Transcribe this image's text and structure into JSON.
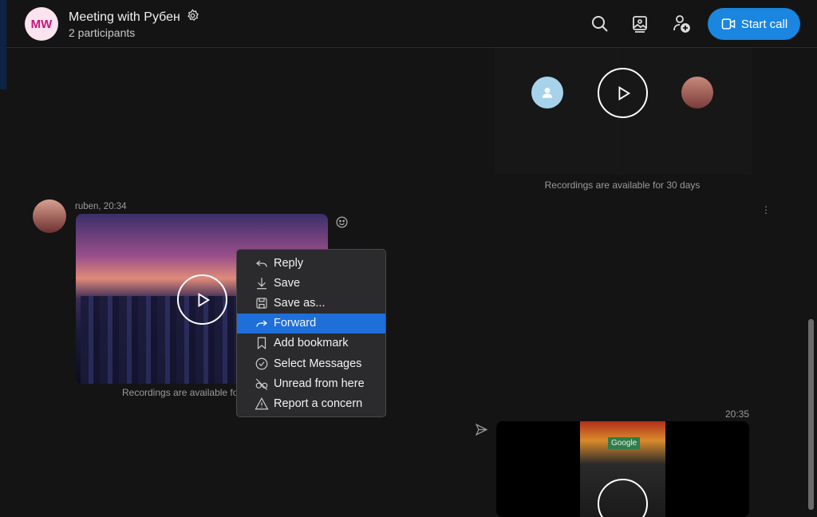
{
  "header": {
    "avatar_initials": "MW",
    "title": "Meeting with Рубен",
    "subtitle": "2 participants",
    "start_call_label": "Start call",
    "icons": [
      "settings-icon",
      "search-icon",
      "gallery-icon",
      "add-participant-icon",
      "video-call-icon"
    ],
    "accent": "#1a86e0"
  },
  "messages": [
    {
      "type": "call-recording",
      "note": "Recordings are available for 30 days"
    },
    {
      "sender": "ruben",
      "meta": "ruben, 20:34",
      "type": "video",
      "note": "Recordings are available for 30 days"
    },
    {
      "type": "video",
      "time": "20:35",
      "thumb_text": "Google"
    }
  ],
  "context_menu": {
    "items": [
      {
        "label": "Reply",
        "icon": "reply-icon"
      },
      {
        "label": "Save",
        "icon": "download-icon"
      },
      {
        "label": "Save as...",
        "icon": "save-icon"
      },
      {
        "label": "Forward",
        "icon": "forward-icon",
        "selected": true
      },
      {
        "label": "Add bookmark",
        "icon": "bookmark-icon"
      },
      {
        "label": "Select Messages",
        "icon": "check-circle-icon"
      },
      {
        "label": "Unread from here",
        "icon": "unread-icon"
      },
      {
        "label": "Report a concern",
        "icon": "warning-icon"
      }
    ]
  }
}
